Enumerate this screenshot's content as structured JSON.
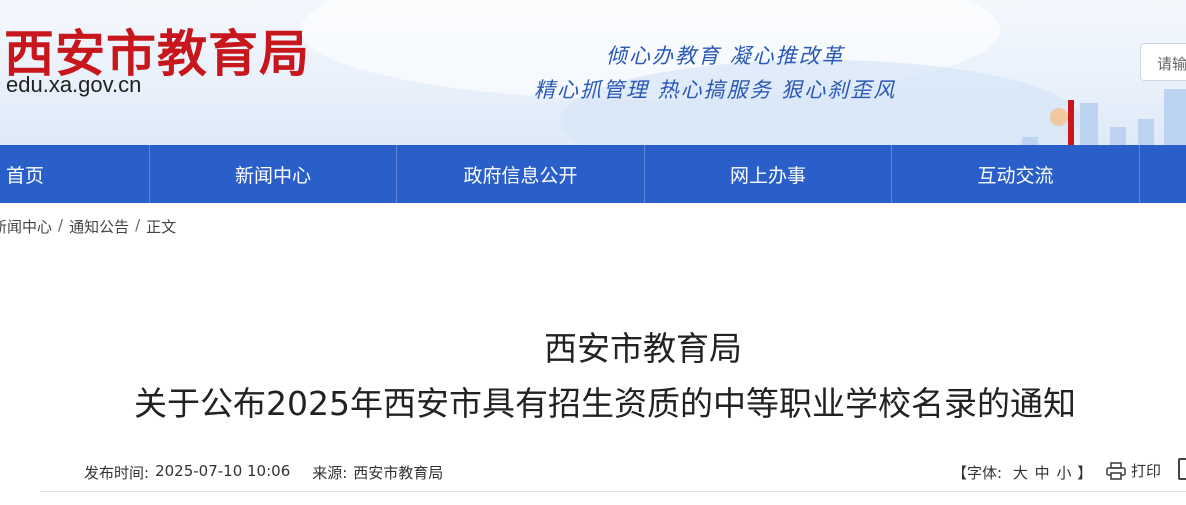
{
  "header": {
    "title": "西安市教育局",
    "domain": "edu.xa.gov.cn",
    "slogan_line1": "倾心办教育  凝心推改革",
    "slogan_line2": "精心抓管理  热心搞服务  狠心刹歪风",
    "search_placeholder": "请输入"
  },
  "nav": {
    "items": [
      "首页",
      "新闻中心",
      "政府信息公开",
      "网上办事",
      "互动交流"
    ]
  },
  "breadcrumb": {
    "items": [
      "新闻中心",
      "通知公告",
      "正文"
    ],
    "separator": "/"
  },
  "article": {
    "title_line1": "西安市教育局",
    "title_line2": "关于公布2025年西安市具有招生资质的中等职业学校名录的通知",
    "publish_label": "发布时间:",
    "publish_time": "2025-07-10 10:06",
    "source_label": "来源:",
    "source": "西安市教育局"
  },
  "tools": {
    "font_prefix": "【字体:",
    "font_large": "大",
    "font_medium": "中",
    "font_small": "小",
    "font_suffix": "】",
    "print_label": "打印"
  },
  "colors": {
    "brand_red": "#c8161d",
    "nav_blue": "#2a5fc9",
    "slogan_blue": "#2a58b6"
  }
}
